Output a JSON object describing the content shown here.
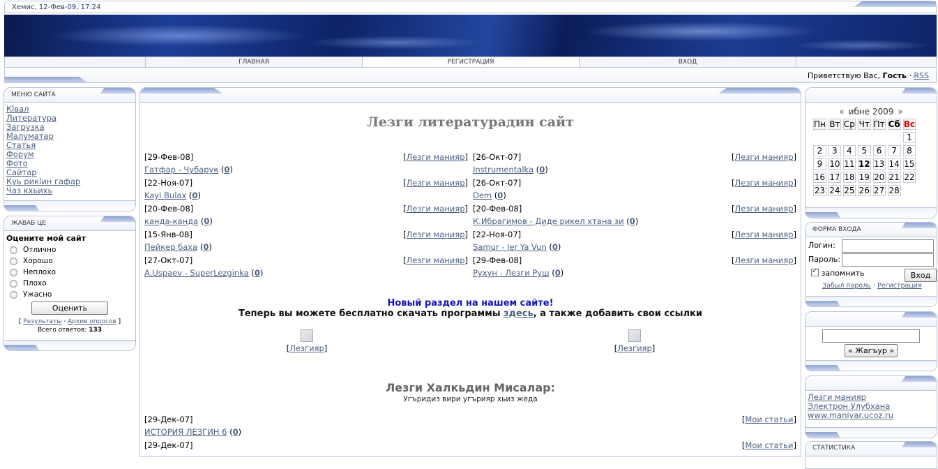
{
  "header": {
    "datetime": "Хемис, 12-Фев-09, 17:24",
    "nav": [
      "Главная",
      "Регистрация",
      "Вход"
    ],
    "greeting_prefix": "Приветствую Вас,",
    "greeting_user": "Гость",
    "rss": "RSS"
  },
  "menu": {
    "title": "Меню сайта",
    "items": [
      "Кlвал",
      "Литература",
      "Загрузка",
      "Малуматар",
      "Статья",
      "Форум",
      "Фото",
      "Сайтар",
      "Куь рикlин гафар",
      "Чаз кхьихь"
    ]
  },
  "poll": {
    "title": "Жаваб це",
    "question": "Оцените мой сайт",
    "options": [
      "Отлично",
      "Хорошо",
      "Неплохо",
      "Плохо",
      "Ужасно"
    ],
    "vote_button": "Оценить",
    "results_link": "Результаты",
    "archive_link": "Архив опросов",
    "total_label": "Всего ответов:",
    "total_value": "133"
  },
  "main": {
    "title": "Лезги литературадин сайт",
    "entries_left": [
      {
        "date": "[29-Фев-08]",
        "category": "Лезги манияр",
        "title": "Гатфар - Чубарук",
        "count": "0"
      },
      {
        "date": "[22-Ноя-07]",
        "category": "Лезги манияр",
        "title": "Kayi Bulax",
        "count": "0"
      },
      {
        "date": "[20-Фев-08]",
        "category": "Лезги манияр",
        "title": "канда-канда",
        "count": "0"
      },
      {
        "date": "[15-Янв-08]",
        "category": "Лезги манияр",
        "title": "Пейкер баха",
        "count": "0"
      },
      {
        "date": "[27-Окт-07]",
        "category": "Лезги манияр",
        "title": "A.Uspaev - SuperLezginka",
        "count": "0"
      }
    ],
    "entries_right": [
      {
        "date": "[26-Окт-07]",
        "category": "Лезги манияр",
        "title": "Instrumentalka",
        "count": "0"
      },
      {
        "date": "[26-Окт-07]",
        "category": "Лезги манияр",
        "title": "Dem",
        "count": "0"
      },
      {
        "date": "[20-Фев-08]",
        "category": "Лезги манияр",
        "title": "К.Ибрагимов - Диде рикел хтана зи",
        "count": "0"
      },
      {
        "date": "[22-Ноя-07]",
        "category": "Лезги манияр",
        "title": "Samur - Ier Ya Vun",
        "count": "0"
      },
      {
        "date": "[29-Фев-08]",
        "category": "Лезги манияр",
        "title": "Рухун - Лезги Руш",
        "count": "0"
      }
    ],
    "promo_line1": "Новый раздел на нашем сайте!",
    "promo_line2_a": "Теперь вы можете бесплатно скачать программы",
    "promo_line2_link": "здесь",
    "promo_line2_b": ", а также добавить свои ссылки",
    "image_caption_left": "Лезгияр",
    "image_caption_right": "Лезгияр",
    "section_title": "Лезги Халкьдин Мисалар:",
    "section_subtitle": "Угъридиз вири угърияр хьиз жеда",
    "articles": [
      {
        "date": "[29-Дек-07]",
        "category": "Мои статьи",
        "title": "ИСТОРИЯ ЛЕЗГИН 6",
        "count": "0"
      },
      {
        "date": "[29-Дек-07]",
        "category": "Мои статьи"
      }
    ]
  },
  "calendar": {
    "month": "ибне 2009",
    "prev": "«",
    "next": "»",
    "weekdays": [
      "Пн",
      "Вт",
      "Ср",
      "Чт",
      "Пт",
      "Сб",
      "Вс"
    ],
    "weeks": [
      [
        "",
        "",
        "",
        "",
        "",
        "",
        "1"
      ],
      [
        "2",
        "3",
        "4",
        "5",
        "6",
        "7",
        "8"
      ],
      [
        "9",
        "10",
        "11",
        "12",
        "13",
        "14",
        "15"
      ],
      [
        "16",
        "17",
        "18",
        "19",
        "20",
        "21",
        "22"
      ],
      [
        "23",
        "24",
        "25",
        "26",
        "27",
        "28",
        ""
      ]
    ],
    "today": "12"
  },
  "login": {
    "title": "Форма входа",
    "login_label": "Логин:",
    "password_label": "Пароль:",
    "remember_label": "запомнить",
    "submit": "Вход",
    "forgot_link": "Забыл пароль",
    "register_link": "Регистрация"
  },
  "search": {
    "button": "« Жагъур »"
  },
  "links": {
    "items": [
      "Лезги манияр",
      "Электрон Улубхана",
      "www.maniyar.ucoz.ru"
    ]
  },
  "stats": {
    "title": "Статистика"
  }
}
